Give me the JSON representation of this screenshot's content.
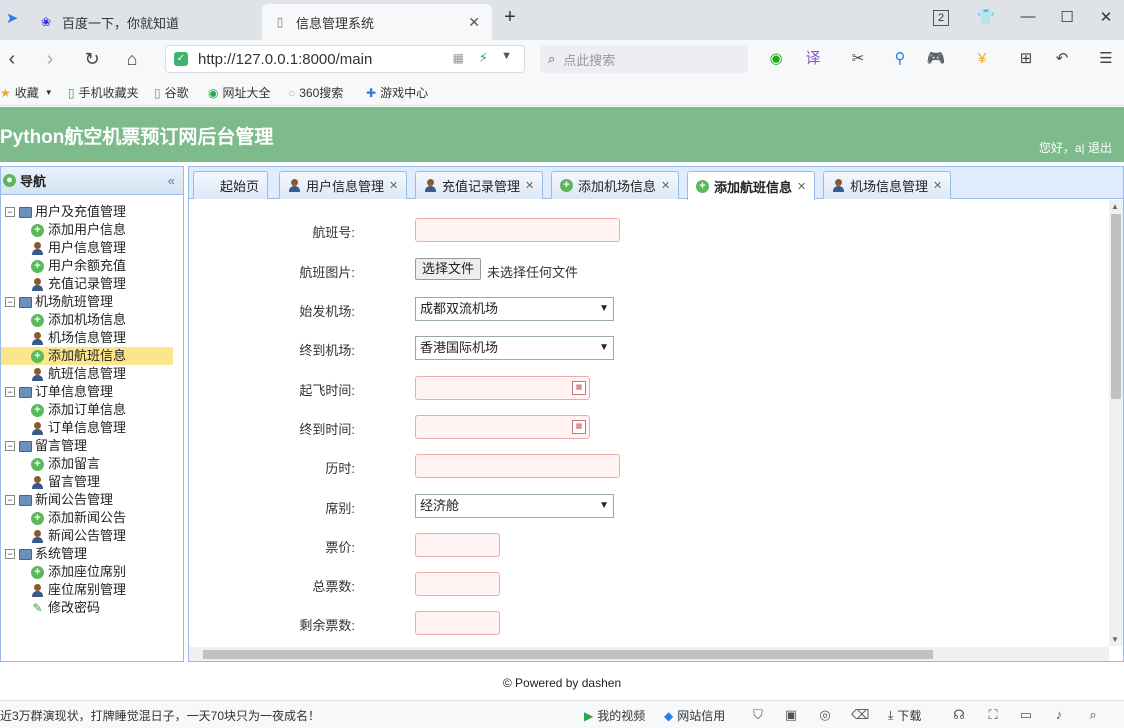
{
  "browser": {
    "tabs": [
      {
        "title": "百度一下，你就知道",
        "icon": "baidu-paw-icon"
      },
      {
        "title": "信息管理系统",
        "icon": "page-icon"
      }
    ],
    "new_tab": "+",
    "tab_count_badge": "2",
    "url": "http://127.0.0.1:8000/main",
    "search_placeholder": "点此搜索",
    "bookmarks": [
      {
        "label": "收藏",
        "icon": "star-icon"
      },
      {
        "label": "手机收藏夹",
        "icon": "phone-icon"
      },
      {
        "label": "谷歌",
        "icon": "page-icon"
      },
      {
        "label": "网址大全",
        "icon": "globe-icon"
      },
      {
        "label": "360搜索",
        "icon": "search-360-icon"
      },
      {
        "label": "游戏中心",
        "icon": "gamepad-icon"
      }
    ]
  },
  "app": {
    "title": "Python航空机票预订网后台管理",
    "user_greeting": "您好，a| 退出"
  },
  "sidebar": {
    "title": "导航",
    "collapse": "«",
    "groups": [
      {
        "label": "用户及充值管理",
        "items": [
          {
            "label": "添加用户信息",
            "icon": "add"
          },
          {
            "label": "用户信息管理",
            "icon": "user"
          },
          {
            "label": "用户余额充值",
            "icon": "add"
          },
          {
            "label": "充值记录管理",
            "icon": "user"
          }
        ]
      },
      {
        "label": "机场航班管理",
        "items": [
          {
            "label": "添加机场信息",
            "icon": "add"
          },
          {
            "label": "机场信息管理",
            "icon": "user"
          },
          {
            "label": "添加航班信息",
            "icon": "add"
          },
          {
            "label": "航班信息管理",
            "icon": "user"
          }
        ]
      },
      {
        "label": "订单信息管理",
        "items": [
          {
            "label": "添加订单信息",
            "icon": "add"
          },
          {
            "label": "订单信息管理",
            "icon": "user"
          }
        ]
      },
      {
        "label": "留言管理",
        "items": [
          {
            "label": "添加留言",
            "icon": "add"
          },
          {
            "label": "留言管理",
            "icon": "user"
          }
        ]
      },
      {
        "label": "新闻公告管理",
        "items": [
          {
            "label": "添加新闻公告",
            "icon": "add"
          },
          {
            "label": "新闻公告管理",
            "icon": "user"
          }
        ]
      },
      {
        "label": "系统管理",
        "items": [
          {
            "label": "添加座位席别",
            "icon": "add"
          },
          {
            "label": "座位席别管理",
            "icon": "user"
          },
          {
            "label": "修改密码",
            "icon": "pen"
          }
        ]
      }
    ]
  },
  "content_tabs": [
    {
      "label": "起始页",
      "icon": "none",
      "closable": false
    },
    {
      "label": "用户信息管理",
      "icon": "user",
      "closable": true
    },
    {
      "label": "充值记录管理",
      "icon": "user",
      "closable": true
    },
    {
      "label": "添加机场信息",
      "icon": "add",
      "closable": true
    },
    {
      "label": "添加航班信息",
      "icon": "add",
      "closable": true,
      "active": true
    },
    {
      "label": "机场信息管理",
      "icon": "user",
      "closable": true
    }
  ],
  "form": {
    "flight_no_label": "航班号:",
    "flight_image_label": "航班图片:",
    "file_button": "选择文件",
    "file_status": "未选择任何文件",
    "from_airport_label": "始发机场:",
    "from_airport_value": "成都双流机场",
    "to_airport_label": "终到机场:",
    "to_airport_value": "香港国际机场",
    "depart_time_label": "起飞时间:",
    "arrive_time_label": "终到时间:",
    "duration_label": "历时:",
    "seat_class_label": "席别:",
    "seat_class_value": "经济舱",
    "price_label": "票价:",
    "total_tickets_label": "总票数:",
    "remaining_tickets_label": "剩余票数:"
  },
  "footer": "© Powered by dashen",
  "statusbar": {
    "news": "近3万群演现状，打牌睡觉混日子，一天70块只为一夜成名！",
    "my_video": "我的视频",
    "site_credit": "网站信用",
    "download": "下载"
  }
}
